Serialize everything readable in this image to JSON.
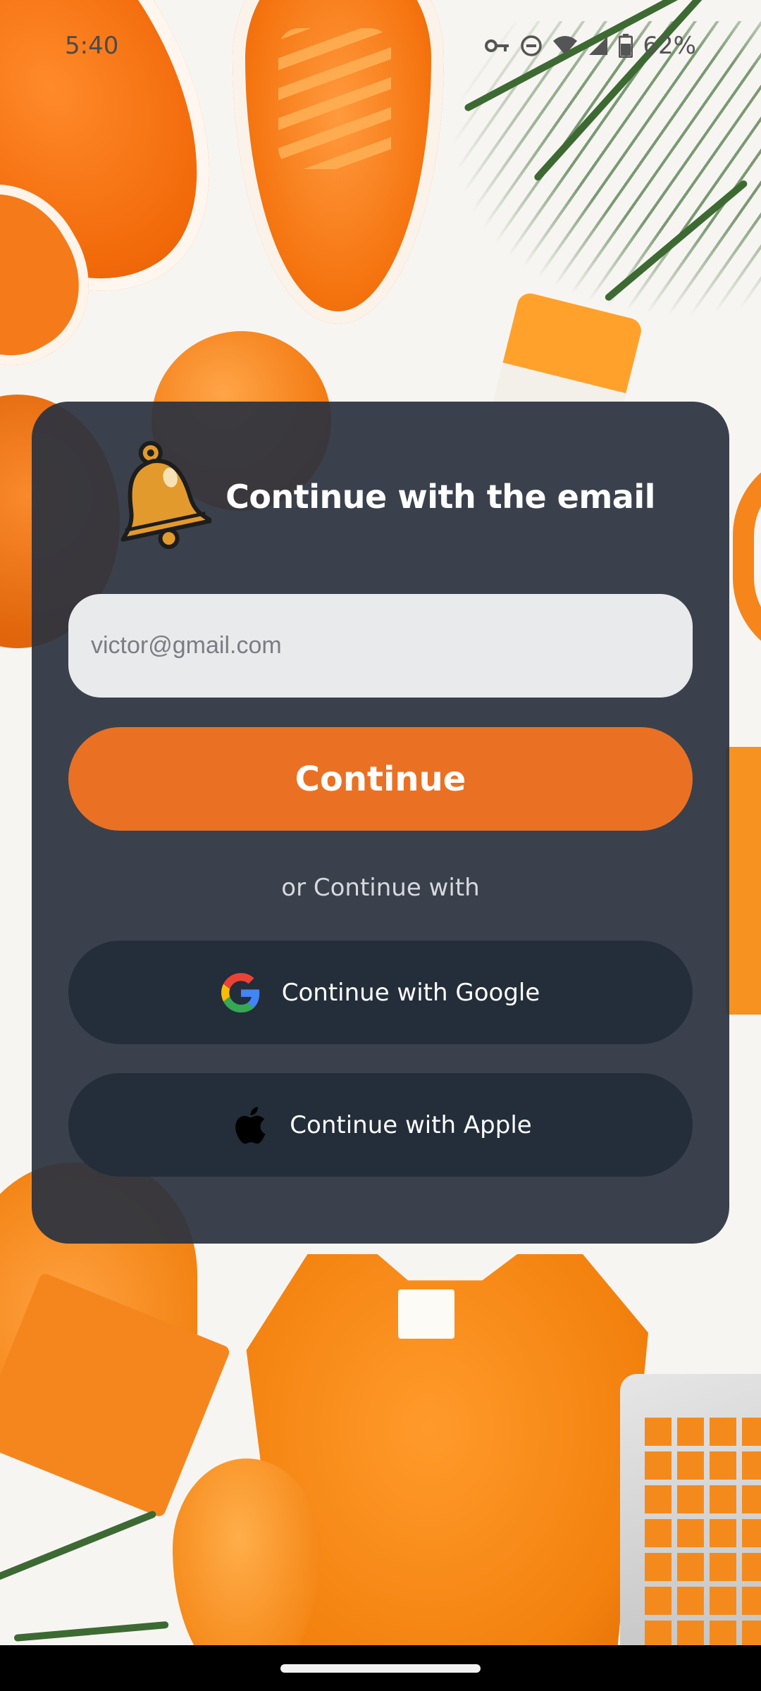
{
  "status_bar": {
    "time": "5:40",
    "battery": "62%",
    "icons": [
      "vpn-key-icon",
      "do-not-disturb-icon",
      "wifi-icon",
      "signal-icon",
      "battery-icon"
    ]
  },
  "card": {
    "icon": "bell-icon",
    "title": "Continue with the email",
    "email_placeholder": "victor@gmail.com",
    "continue_label": "Continue",
    "divider_text": "or Continue with",
    "google_label": "Continue with Google",
    "apple_label": "Continue with Apple"
  },
  "colors": {
    "accent": "#ea7124",
    "card_bg": "#2b333f",
    "social_button_bg": "#242d3a",
    "input_bg": "#e9eaec"
  }
}
